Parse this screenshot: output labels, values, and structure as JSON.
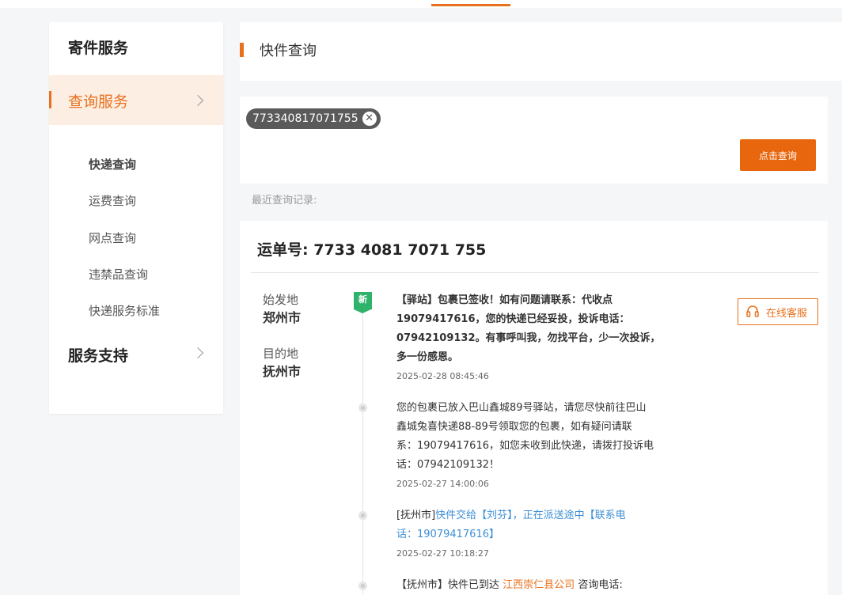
{
  "sidebar": {
    "title": "寄件服务",
    "active_section": "查询服务",
    "items": [
      {
        "label": "快递查询",
        "active": true
      },
      {
        "label": "运费查询"
      },
      {
        "label": "网点查询"
      },
      {
        "label": "违禁品查询"
      },
      {
        "label": "快递服务标准"
      }
    ],
    "support_section": "服务支持"
  },
  "header": {
    "title": "快件查询"
  },
  "search": {
    "tag_value": "773340817071755",
    "clear_icon": "close-icon",
    "button_label": "点击查询"
  },
  "recent_label": "最近查询记录:",
  "result": {
    "waybill_label": "运单号",
    "waybill_number": ": 7733 4081 7071 755",
    "origin_label": "始发地",
    "origin_city": "郑州市",
    "dest_label": "目的地",
    "dest_city": "抚州市",
    "new_badge": "新",
    "customer_service": "在线客服",
    "events": [
      {
        "text_lines": [
          "【驿站】包裹已签收！如有问题请联系：代收点",
          "19079417616，您的快递已经妥投，投诉电话：",
          "07942109132。有事呼叫我，勿找平台，少一次投诉，",
          "多一份感恩。"
        ],
        "time": "2025-02-28 08:45:46"
      },
      {
        "text_lines": [
          "您的包裹已放入巴山鑫城89号驿站，请您尽快前往巴山",
          "鑫城兔喜快递88-89号领取您的包裹，如有疑问请联",
          "系：19079417616，如您未收到此快递，请拨打投诉电",
          "话：07942109132！"
        ],
        "time": "2025-02-27 14:00:06"
      },
      {
        "prefix": "[抚州市]",
        "text_lines": [
          "快件交给【刘芬】，正在派送途中【联系电",
          "话：19079417616】"
        ],
        "time": "2025-02-27 10:18:27"
      },
      {
        "prefix": "【抚州市】快件已到达",
        "company": "江西崇仁县公司",
        "suffix": "咨询电话:"
      }
    ]
  },
  "colors": {
    "accent": "#e8711f",
    "button": "#e8660d",
    "new_badge": "#2fb36b",
    "link": "#3d8fd6"
  }
}
